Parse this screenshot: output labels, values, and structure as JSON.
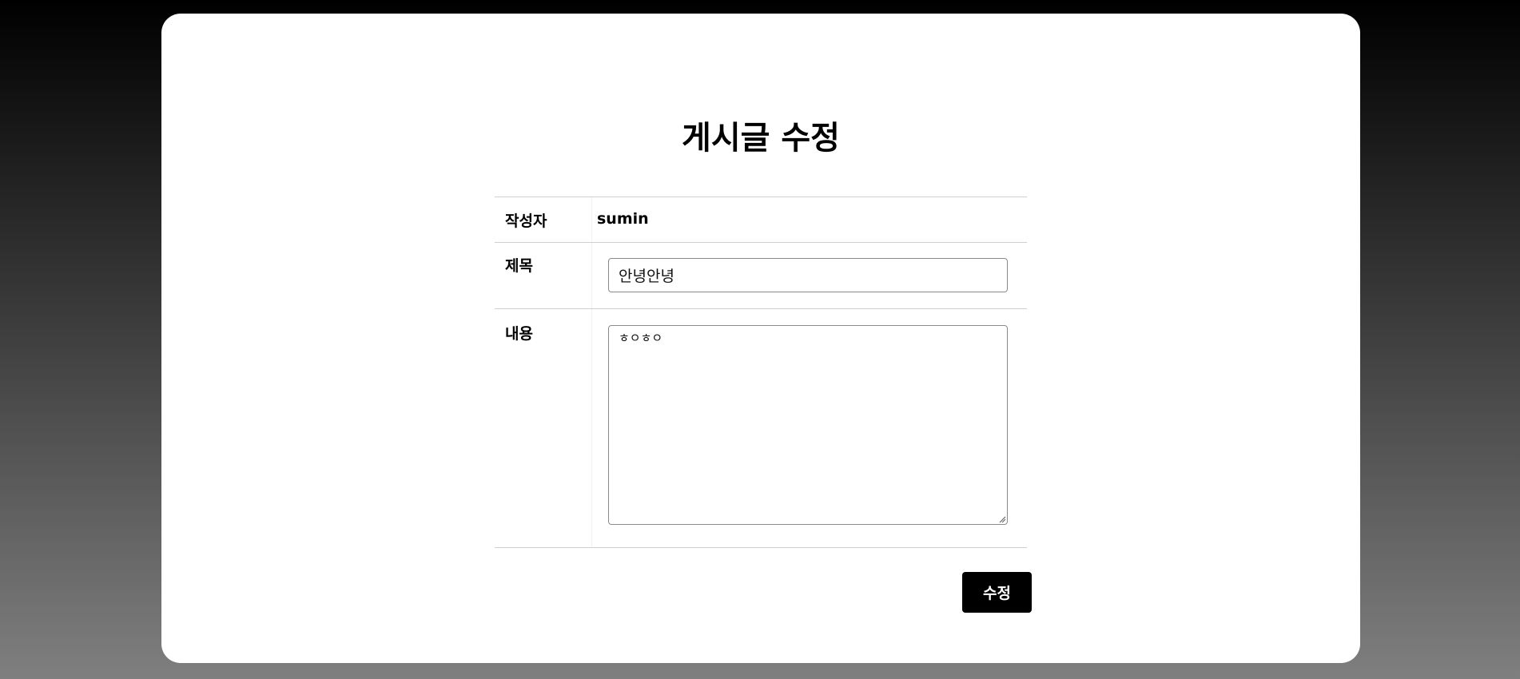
{
  "page": {
    "title": "게시글 수정"
  },
  "form": {
    "author_label": "작성자",
    "author_value": "sumin",
    "title_label": "제목",
    "title_value": "안녕안녕",
    "content_label": "내용",
    "content_value": "ㅎㅇㅎㅇ"
  },
  "actions": {
    "submit_label": "수정"
  },
  "colors": {
    "background_top": "#000000",
    "background_bottom": "#7f7f7f",
    "card": "#ffffff",
    "button": "#000000",
    "button_text": "#ffffff"
  }
}
